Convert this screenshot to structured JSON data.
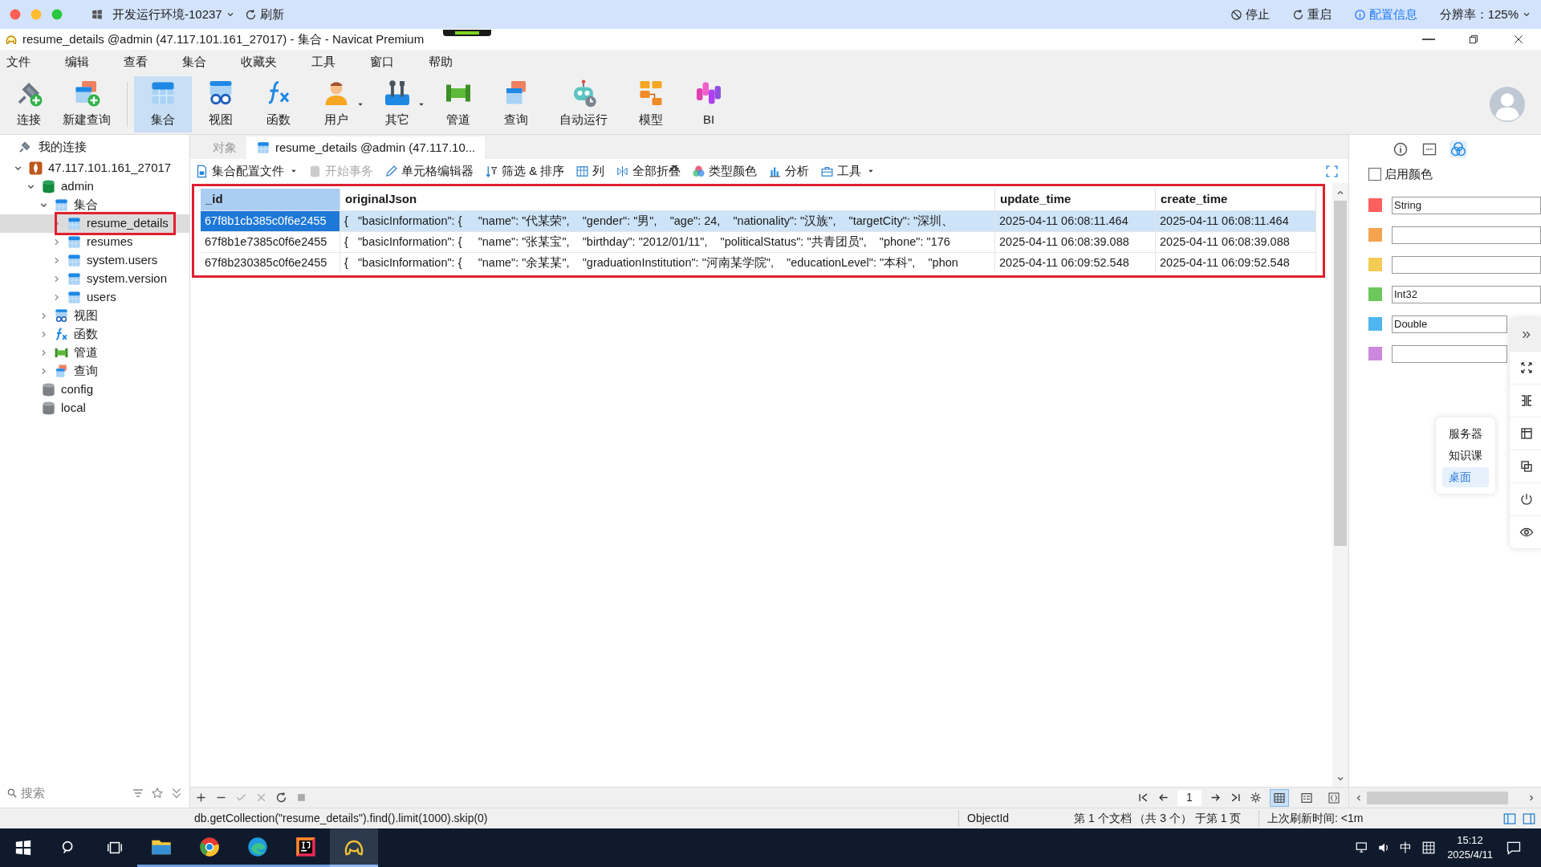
{
  "top_bar": {
    "env": "开发运行环境-10237",
    "refresh": "刷新",
    "actions": [
      {
        "label": "停止",
        "kind": "stop"
      },
      {
        "label": "重启",
        "kind": "restart"
      },
      {
        "label": "配置信息",
        "kind": "info"
      }
    ],
    "resolution": "分辨率：125%"
  },
  "window": {
    "title": "resume_details @admin (47.117.101.161_27017) - 集合 - Navicat Premium"
  },
  "menu": [
    "文件",
    "编辑",
    "查看",
    "集合",
    "收藏夹",
    "工具",
    "窗口",
    "帮助"
  ],
  "toolbar": [
    {
      "label": "连接",
      "kind": "connect",
      "selected": false
    },
    {
      "label": "新建查询",
      "kind": "new-query",
      "selected": false
    },
    {
      "label": "集合",
      "kind": "collection",
      "selected": true
    },
    {
      "label": "视图",
      "kind": "view",
      "selected": false
    },
    {
      "label": "函数",
      "kind": "function",
      "selected": false
    },
    {
      "label": "用户",
      "kind": "user",
      "selected": false,
      "dropdown": true
    },
    {
      "label": "其它",
      "kind": "other",
      "selected": false,
      "dropdown": true
    },
    {
      "label": "管道",
      "kind": "pipeline",
      "selected": false
    },
    {
      "label": "查询",
      "kind": "query",
      "selected": false
    },
    {
      "label": "自动运行",
      "kind": "automation",
      "selected": false
    },
    {
      "label": "模型",
      "kind": "model",
      "selected": false
    },
    {
      "label": "BI",
      "kind": "bi",
      "selected": false
    }
  ],
  "sidebar": {
    "header": "我的连接",
    "tree": [
      {
        "label": "47.117.101.161_27017",
        "kind": "server",
        "expanded": true,
        "selected": false,
        "children": [
          {
            "label": "admin",
            "kind": "database",
            "expanded": true,
            "selected": false,
            "children": [
              {
                "label": "集合",
                "kind": "collection-group",
                "expanded": true,
                "selected": false,
                "children": [
                  {
                    "label": "resume_details",
                    "kind": "collection",
                    "expanded": false,
                    "selected": true,
                    "marked": true
                  },
                  {
                    "label": "resumes",
                    "kind": "collection",
                    "expanded": false,
                    "selected": false
                  },
                  {
                    "label": "system.users",
                    "kind": "collection",
                    "expanded": false,
                    "selected": false
                  },
                  {
                    "label": "system.version",
                    "kind": "collection",
                    "expanded": false,
                    "selected": false
                  },
                  {
                    "label": "users",
                    "kind": "collection",
                    "expanded": false,
                    "selected": false
                  }
                ]
              },
              {
                "label": "视图",
                "kind": "view-group",
                "expanded": false,
                "selected": false
              },
              {
                "label": "函数",
                "kind": "function-group",
                "expanded": false,
                "selected": false
              },
              {
                "label": "管道",
                "kind": "pipeline-group",
                "expanded": false,
                "selected": false
              },
              {
                "label": "查询",
                "kind": "query-group",
                "expanded": false,
                "selected": false
              }
            ]
          },
          {
            "label": "config",
            "kind": "database-gray",
            "selected": false
          },
          {
            "label": "local",
            "kind": "database-gray",
            "selected": false
          }
        ]
      }
    ],
    "search": {
      "placeholder": "搜索"
    }
  },
  "tabs": [
    {
      "label": "对象",
      "selected": false
    },
    {
      "label": "resume_details @admin (47.117.10...",
      "selected": true
    }
  ],
  "subtoolbar": [
    {
      "label": "集合配置文件",
      "kind": "profile",
      "dropdown": true,
      "disabled": false
    },
    {
      "label": "开始事务",
      "kind": "transaction",
      "disabled": true
    },
    {
      "label": "单元格编辑器",
      "kind": "editor",
      "disabled": false
    },
    {
      "label": "筛选 & 排序",
      "kind": "filter",
      "disabled": false
    },
    {
      "label": "列",
      "kind": "columns",
      "disabled": false
    },
    {
      "label": "全部折叠",
      "kind": "collapse",
      "disabled": false
    },
    {
      "label": "类型颜色",
      "kind": "colors",
      "disabled": false
    },
    {
      "label": "分析",
      "kind": "analyze",
      "disabled": false
    },
    {
      "label": "工具",
      "kind": "tools",
      "dropdown": true,
      "disabled": false
    }
  ],
  "table": {
    "marked": true,
    "columns": [
      {
        "label": "_id",
        "selected": true
      },
      {
        "label": "originalJson",
        "selected": false
      },
      {
        "label": "update_time",
        "selected": false
      },
      {
        "label": "create_time",
        "selected": false
      }
    ],
    "rows": [
      {
        "selected": true,
        "cells": [
          "67f8b1cb385c0f6e2455",
          "{   \"basicInformation\": {     \"name\": \"代某荣\",    \"gender\": \"男\",    \"age\": 24,    \"nationality\": \"汉族\",    \"targetCity\": \"深圳、",
          "2025-04-11 06:08:11.464",
          "2025-04-11 06:08:11.464"
        ]
      },
      {
        "selected": false,
        "cells": [
          "67f8b1e7385c0f6e2455",
          "{   \"basicInformation\": {     \"name\": \"张某宝\",    \"birthday\": \"2012/01/11\",    \"politicalStatus\": \"共青团员\",    \"phone\": \"176",
          "2025-04-11 06:08:39.088",
          "2025-04-11 06:08:39.088"
        ]
      },
      {
        "selected": false,
        "cells": [
          "67f8b230385c0f6e2455",
          "{   \"basicInformation\": {     \"name\": \"余某某\",    \"graduationInstitution\": \"河南某学院\",    \"educationLevel\": \"本科\",    \"phon",
          "2025-04-11 06:09:52.548",
          "2025-04-11 06:09:52.548"
        ]
      }
    ]
  },
  "pager": {
    "page": "1"
  },
  "views": [
    {
      "kind": "grid",
      "selected": true
    },
    {
      "kind": "form",
      "selected": false
    },
    {
      "kind": "json",
      "selected": false
    }
  ],
  "right_panel": {
    "tabs": [
      {
        "kind": "info",
        "selected": false
      },
      {
        "kind": "ddl",
        "selected": false
      },
      {
        "kind": "colors",
        "selected": true
      }
    ],
    "enable_colors": {
      "label": "启用颜色",
      "checked": false
    },
    "type_colors": [
      {
        "color": "#fe5f5f",
        "value": "String"
      },
      {
        "color": "#f5a34f"
      },
      {
        "color": "#f3cb55"
      },
      {
        "color": "#6cc85a",
        "value": "Int32"
      },
      {
        "color": "#4fb6f0",
        "value": "Double"
      },
      {
        "color": "#cc88dd"
      }
    ]
  },
  "dock": {
    "menu": [
      {
        "label": "服务器",
        "selected": false
      },
      {
        "label": "知识课",
        "selected": false
      },
      {
        "label": "桌面",
        "selected": true
      }
    ]
  },
  "status_bar": {
    "query": "db.getCollection(\"resume_details\").find().limit(1000).skip(0)",
    "type": "ObjectId",
    "position": "第 1 个文档 （共 3 个） 于第 1 页",
    "refreshed": "上次刷新时间: <1m"
  },
  "taskbar": {
    "apps": [
      {
        "kind": "explorer",
        "selected": false
      },
      {
        "kind": "chrome",
        "selected": false
      },
      {
        "kind": "edge",
        "selected": false
      },
      {
        "kind": "ide",
        "selected": false
      },
      {
        "kind": "navicat",
        "selected": true
      }
    ],
    "ime": "中",
    "time": "15:12",
    "date": "2025/4/11"
  }
}
